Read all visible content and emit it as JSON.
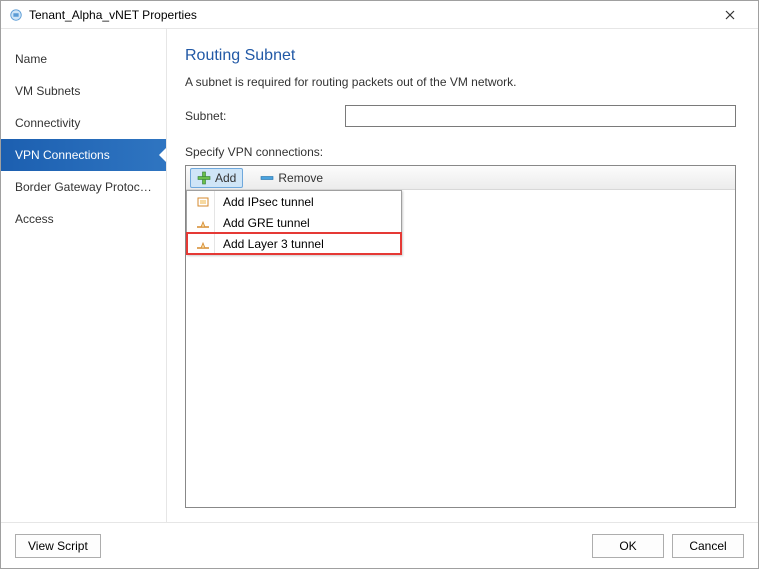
{
  "window": {
    "title": "Tenant_Alpha_vNET Properties"
  },
  "sidebar": {
    "items": [
      {
        "label": "Name",
        "selected": false
      },
      {
        "label": "VM Subnets",
        "selected": false
      },
      {
        "label": "Connectivity",
        "selected": false
      },
      {
        "label": "VPN Connections",
        "selected": true
      },
      {
        "label": "Border Gateway Protocol...",
        "selected": false
      },
      {
        "label": "Access",
        "selected": false
      }
    ]
  },
  "main": {
    "heading": "Routing Subnet",
    "description": "A subnet is required for routing packets out of the VM network.",
    "subnet_label": "Subnet:",
    "subnet_value": "",
    "specify_label": "Specify VPN connections:",
    "toolbar": {
      "add": "Add",
      "remove": "Remove"
    },
    "menu": [
      {
        "label": "Add IPsec tunnel",
        "icon": "ipsec",
        "outlined": false
      },
      {
        "label": "Add GRE tunnel",
        "icon": "tunnel",
        "outlined": false
      },
      {
        "label": "Add Layer 3 tunnel",
        "icon": "tunnel",
        "outlined": true
      }
    ]
  },
  "footer": {
    "view_script": "View Script",
    "ok": "OK",
    "cancel": "Cancel"
  }
}
